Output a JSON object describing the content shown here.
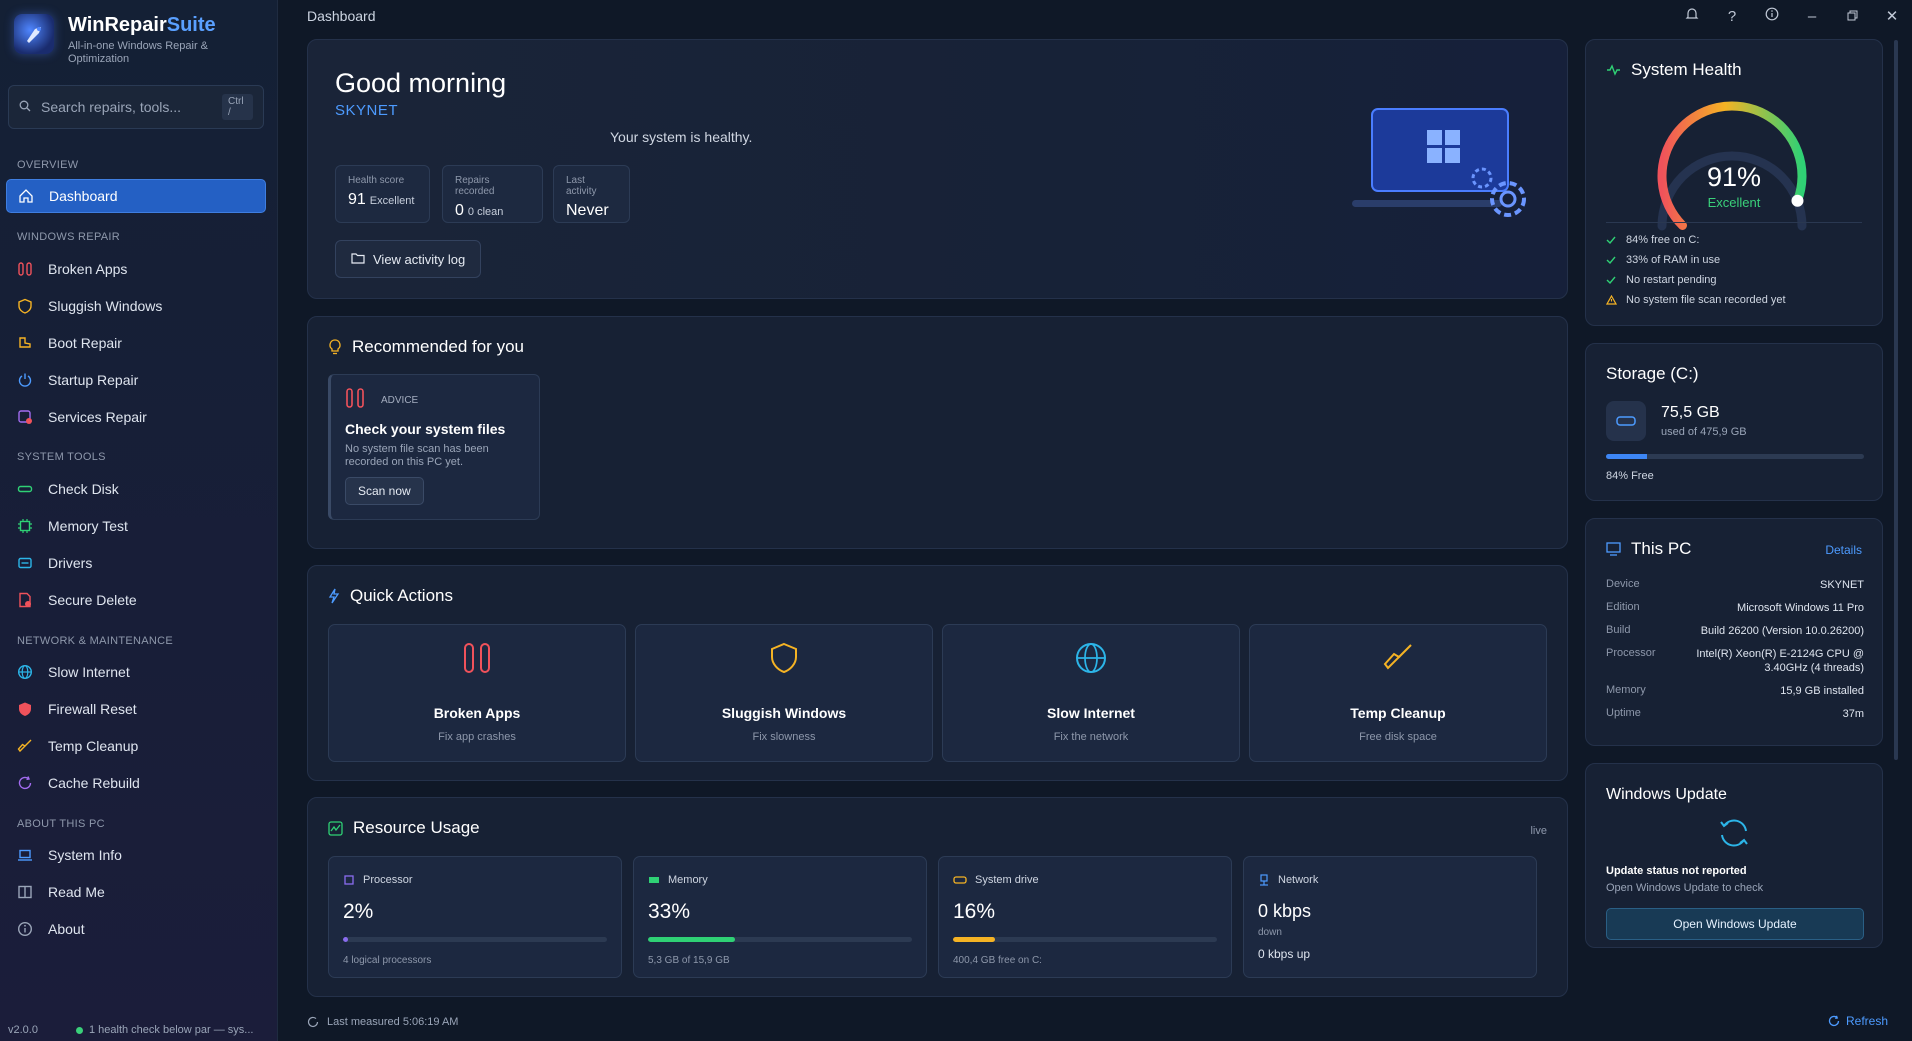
{
  "app": {
    "name_main": "WinRepair",
    "name_accent": "Suite",
    "subtitle": "All-in-one Windows Repair & Optimization",
    "version": "v2.0.0",
    "status_text": "1 health check below par — sys..."
  },
  "search": {
    "placeholder": "Search repairs, tools...",
    "shortcut": "Ctrl /"
  },
  "sidebar": {
    "sections": [
      {
        "title": "OVERVIEW",
        "items": [
          {
            "label": "Dashboard",
            "icon": "home-icon",
            "active": true
          }
        ]
      },
      {
        "title": "WINDOWS REPAIR",
        "items": [
          {
            "label": "Broken Apps",
            "icon": "wrench-screwdriver-icon"
          },
          {
            "label": "Sluggish Windows",
            "icon": "shield-icon"
          },
          {
            "label": "Boot Repair",
            "icon": "boot-icon"
          },
          {
            "label": "Startup Repair",
            "icon": "power-icon"
          },
          {
            "label": "Services Repair",
            "icon": "services-icon"
          }
        ]
      },
      {
        "title": "SYSTEM TOOLS",
        "items": [
          {
            "label": "Check Disk",
            "icon": "disk-icon"
          },
          {
            "label": "Memory Test",
            "icon": "chip-icon"
          },
          {
            "label": "Drivers",
            "icon": "driver-icon"
          },
          {
            "label": "Secure Delete",
            "icon": "delete-file-icon"
          }
        ]
      },
      {
        "title": "NETWORK & MAINTENANCE",
        "items": [
          {
            "label": "Slow Internet",
            "icon": "globe-icon"
          },
          {
            "label": "Firewall Reset",
            "icon": "firewall-icon"
          },
          {
            "label": "Temp Cleanup",
            "icon": "broom-icon"
          },
          {
            "label": "Cache Rebuild",
            "icon": "refresh-icon"
          }
        ]
      },
      {
        "title": "ABOUT THIS PC",
        "items": [
          {
            "label": "System Info",
            "icon": "laptop-icon"
          },
          {
            "label": "Read Me",
            "icon": "book-icon"
          },
          {
            "label": "About",
            "icon": "info-icon"
          }
        ]
      }
    ]
  },
  "topbar": {
    "title": "Dashboard"
  },
  "hero": {
    "greeting": "Good morning",
    "machine": "SKYNET",
    "status": "Your system is healthy.",
    "stats": [
      {
        "label": "Health score",
        "value": "91",
        "suffix": "Excellent"
      },
      {
        "label": "Repairs recorded",
        "value": "0",
        "suffix": "0 clean"
      },
      {
        "label": "Last activity",
        "value": "Never",
        "suffix": ""
      }
    ],
    "activity_button": "View activity log"
  },
  "recommended": {
    "title": "Recommended for you",
    "card": {
      "tag": "ADVICE",
      "title": "Check your system files",
      "description": "No system file scan has been recorded on this PC yet.",
      "button": "Scan now"
    }
  },
  "quick_actions": {
    "title": "Quick Actions",
    "items": [
      {
        "name": "Broken Apps",
        "sub": "Fix app crashes",
        "icon": "wrench-screwdriver-icon",
        "color": "#f0525b"
      },
      {
        "name": "Sluggish Windows",
        "sub": "Fix slowness",
        "icon": "shield-icon",
        "color": "#f5b324"
      },
      {
        "name": "Slow Internet",
        "sub": "Fix the network",
        "icon": "globe-icon",
        "color": "#2cb5e8"
      },
      {
        "name": "Temp Cleanup",
        "sub": "Free disk space",
        "icon": "broom-icon",
        "color": "#f5b324"
      }
    ]
  },
  "resources": {
    "title": "Resource Usage",
    "live": "live",
    "processor": {
      "label": "Processor",
      "value": "2%",
      "percent": 2,
      "sub": "4 logical processors",
      "color": "#8a6cf0"
    },
    "memory": {
      "label": "Memory",
      "value": "33%",
      "percent": 33,
      "sub": "5,3 GB of 15,9 GB",
      "color": "#2fd175"
    },
    "drive": {
      "label": "System drive",
      "value": "16%",
      "percent": 16,
      "sub": "400,4 GB free on C:",
      "color": "#f5b324"
    },
    "network": {
      "label": "Network",
      "down_value": "0 kbps",
      "down_label": "down",
      "up": "0 kbps up"
    },
    "last_measured": "Last measured 5:06:19 AM",
    "refresh": "Refresh"
  },
  "health": {
    "title": "System Health",
    "percent": "91%",
    "percent_value": 91,
    "rating": "Excellent",
    "checks": [
      {
        "text": "84% free on C:",
        "status": "ok"
      },
      {
        "text": "33% of RAM in use",
        "status": "ok"
      },
      {
        "text": "No restart pending",
        "status": "ok"
      },
      {
        "text": "No system file scan recorded yet",
        "status": "warn"
      }
    ]
  },
  "storage": {
    "title": "Storage (C:)",
    "used": "75,5 GB",
    "of": "used of 475,9 GB",
    "used_fraction": 0.16,
    "free": "84% Free"
  },
  "this_pc": {
    "title": "This PC",
    "details": "Details",
    "rows": [
      {
        "key": "Device",
        "value": "SKYNET"
      },
      {
        "key": "Edition",
        "value": "Microsoft Windows 11 Pro"
      },
      {
        "key": "Build",
        "value": "Build 26200 (Version 10.0.26200)"
      },
      {
        "key": "Processor",
        "value": "Intel(R) Xeon(R) E-2124G CPU @ 3.40GHz (4 threads)"
      },
      {
        "key": "Memory",
        "value": "15,9 GB installed"
      },
      {
        "key": "Uptime",
        "value": "37m"
      }
    ]
  },
  "windows_update": {
    "title": "Windows Update",
    "message": "Update status not reported",
    "hint": "Open Windows Update to check",
    "button": "Open Windows Update"
  }
}
